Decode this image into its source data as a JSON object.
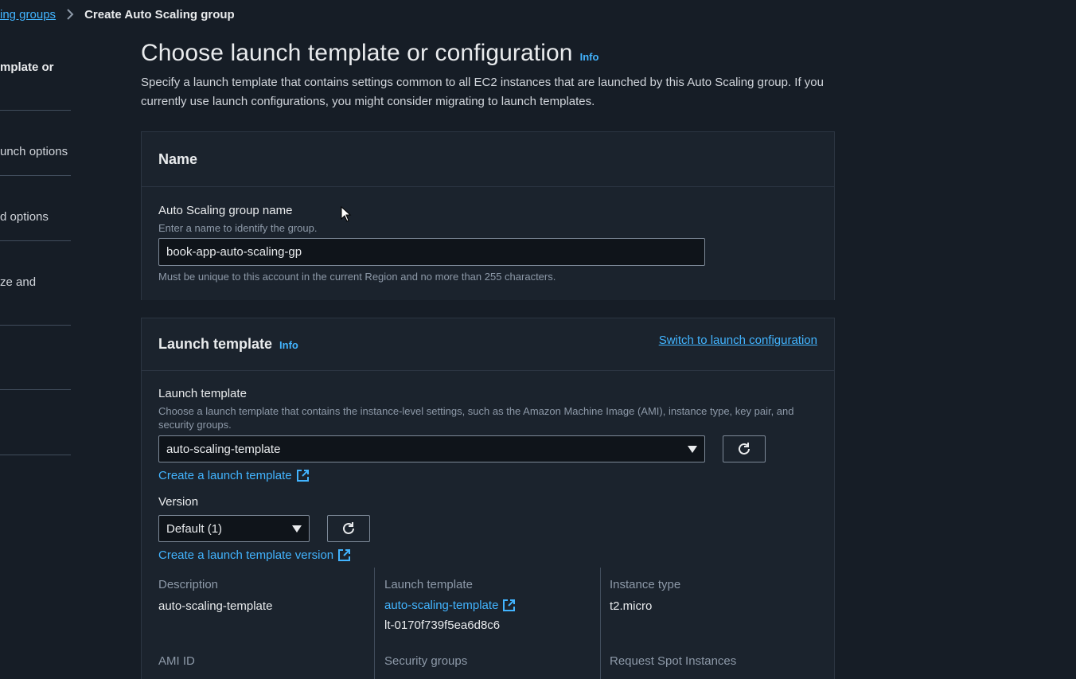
{
  "breadcrumb": {
    "parent": "ing groups",
    "current": "Create Auto Scaling group"
  },
  "steps": [
    {
      "label": "mplate or"
    },
    {
      "label": "unch options"
    },
    {
      "label": "d options"
    },
    {
      "label": "ze and"
    }
  ],
  "header": {
    "title": "Choose launch template or configuration",
    "info": "Info",
    "description": "Specify a launch template that contains settings common to all EC2 instances that are launched by this Auto Scaling group. If you currently use launch configurations, you might consider migrating to launch templates."
  },
  "name_panel": {
    "title": "Name",
    "field_label": "Auto Scaling group name",
    "field_hint": "Enter a name to identify the group.",
    "field_value": "book-app-auto-scaling-gp",
    "field_constraint": "Must be unique to this account in the current Region and no more than 255 characters."
  },
  "launch_panel": {
    "title": "Launch template",
    "info": "Info",
    "switch_link": "Switch to launch configuration",
    "template_label": "Launch template",
    "template_hint": "Choose a launch template that contains the instance-level settings, such as the Amazon Machine Image (AMI), instance type, key pair, and security groups.",
    "template_selected": "auto-scaling-template",
    "create_template_link": "Create a launch template",
    "version_label": "Version",
    "version_selected": "Default (1)",
    "create_version_link": "Create a launch template version",
    "details": {
      "description_label": "Description",
      "description_value": "auto-scaling-template",
      "template_label": "Launch template",
      "template_link": "auto-scaling-template",
      "template_id": "lt-0170f739f5ea6d8c6",
      "instance_type_label": "Instance type",
      "instance_type_value": "t2.micro",
      "ami_label": "AMI ID",
      "security_groups_label": "Security groups",
      "spot_label": "Request Spot Instances"
    }
  },
  "icons": {
    "refresh": "refresh-icon",
    "external": "external-link-icon",
    "chevron": "chevron-right-icon",
    "caret": "caret-down-icon"
  }
}
